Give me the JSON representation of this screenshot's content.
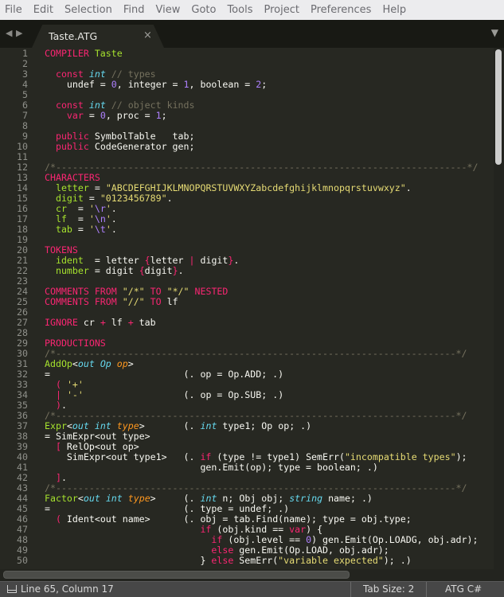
{
  "menu": [
    "File",
    "Edit",
    "Selection",
    "Find",
    "View",
    "Goto",
    "Tools",
    "Project",
    "Preferences",
    "Help"
  ],
  "tab": {
    "title": "Taste.ATG",
    "close": "×"
  },
  "icons": {
    "nav_back": "◀",
    "nav_forward": "▶",
    "tab_menu": "▼"
  },
  "colors": {
    "background": "#272822",
    "keyword": "#f92672",
    "entity": "#a6e22e",
    "type": "#66d9ef",
    "parameter": "#fd971f",
    "string": "#e6db74",
    "comment": "#75715e",
    "number": "#ae81ff",
    "text": "#f8f8f2"
  },
  "status": {
    "position": "Line 65, Column 17",
    "tab_size": "Tab Size: 2",
    "syntax": "ATG C#"
  },
  "lines": [
    [
      [
        "k",
        "COMPILER"
      ],
      [
        "p",
        " "
      ],
      [
        "g",
        "Taste"
      ]
    ],
    [],
    [
      [
        "p",
        "  "
      ],
      [
        "k",
        "const"
      ],
      [
        "p",
        " "
      ],
      [
        "t",
        "int"
      ],
      [
        "p",
        " "
      ],
      [
        "c",
        "// types"
      ]
    ],
    [
      [
        "p",
        "    undef = "
      ],
      [
        "n",
        "0"
      ],
      [
        "p",
        ", integer = "
      ],
      [
        "n",
        "1"
      ],
      [
        "p",
        ", boolean = "
      ],
      [
        "n",
        "2"
      ],
      [
        "p",
        ";"
      ]
    ],
    [],
    [
      [
        "p",
        "  "
      ],
      [
        "k",
        "const"
      ],
      [
        "p",
        " "
      ],
      [
        "t",
        "int"
      ],
      [
        "p",
        " "
      ],
      [
        "c",
        "// object kinds"
      ]
    ],
    [
      [
        "p",
        "    "
      ],
      [
        "k",
        "var"
      ],
      [
        "p",
        " = "
      ],
      [
        "n",
        "0"
      ],
      [
        "p",
        ", proc = "
      ],
      [
        "n",
        "1"
      ],
      [
        "p",
        ";"
      ]
    ],
    [],
    [
      [
        "p",
        "  "
      ],
      [
        "k",
        "public"
      ],
      [
        "p",
        " SymbolTable   tab;"
      ]
    ],
    [
      [
        "p",
        "  "
      ],
      [
        "k",
        "public"
      ],
      [
        "p",
        " CodeGenerator gen;"
      ]
    ],
    [],
    [
      [
        "c",
        "/*--------------------------------------------------------------------------*/"
      ]
    ],
    [
      [
        "k",
        "CHARACTERS"
      ]
    ],
    [
      [
        "p",
        "  "
      ],
      [
        "g",
        "letter"
      ],
      [
        "p",
        " = "
      ],
      [
        "s",
        "\"ABCDEFGHIJKLMNOPQRSTUVWXYZabcdefghijklmnopqrstuvwxyz\""
      ],
      [
        "p",
        "."
      ]
    ],
    [
      [
        "p",
        "  "
      ],
      [
        "g",
        "digit"
      ],
      [
        "p",
        " = "
      ],
      [
        "s",
        "\"0123456789\""
      ],
      [
        "p",
        "."
      ]
    ],
    [
      [
        "p",
        "  "
      ],
      [
        "g",
        "cr"
      ],
      [
        "p",
        "  = "
      ],
      [
        "s",
        "'"
      ],
      [
        "n",
        "\\r"
      ],
      [
        "s",
        "'"
      ],
      [
        "p",
        "."
      ]
    ],
    [
      [
        "p",
        "  "
      ],
      [
        "g",
        "lf"
      ],
      [
        "p",
        "  = "
      ],
      [
        "s",
        "'"
      ],
      [
        "n",
        "\\n"
      ],
      [
        "s",
        "'"
      ],
      [
        "p",
        "."
      ]
    ],
    [
      [
        "p",
        "  "
      ],
      [
        "g",
        "tab"
      ],
      [
        "p",
        " = "
      ],
      [
        "s",
        "'"
      ],
      [
        "n",
        "\\t"
      ],
      [
        "s",
        "'"
      ],
      [
        "p",
        "."
      ]
    ],
    [],
    [
      [
        "k",
        "TOKENS"
      ]
    ],
    [
      [
        "p",
        "  "
      ],
      [
        "g",
        "ident"
      ],
      [
        "p",
        "  = letter "
      ],
      [
        "k",
        "{"
      ],
      [
        "p",
        "letter "
      ],
      [
        "k",
        "|"
      ],
      [
        "p",
        " digit"
      ],
      [
        "k",
        "}"
      ],
      [
        "p",
        "."
      ]
    ],
    [
      [
        "p",
        "  "
      ],
      [
        "g",
        "number"
      ],
      [
        "p",
        " = digit "
      ],
      [
        "k",
        "{"
      ],
      [
        "p",
        "digit"
      ],
      [
        "k",
        "}"
      ],
      [
        "p",
        "."
      ]
    ],
    [],
    [
      [
        "k",
        "COMMENTS FROM"
      ],
      [
        "p",
        " "
      ],
      [
        "s",
        "\"/*\""
      ],
      [
        "p",
        " "
      ],
      [
        "k",
        "TO"
      ],
      [
        "p",
        " "
      ],
      [
        "s",
        "\"*/\""
      ],
      [
        "p",
        " "
      ],
      [
        "k",
        "NESTED"
      ]
    ],
    [
      [
        "k",
        "COMMENTS FROM"
      ],
      [
        "p",
        " "
      ],
      [
        "s",
        "\"//\""
      ],
      [
        "p",
        " "
      ],
      [
        "k",
        "TO"
      ],
      [
        "p",
        " lf"
      ]
    ],
    [],
    [
      [
        "k",
        "IGNORE"
      ],
      [
        "p",
        " cr "
      ],
      [
        "k",
        "+"
      ],
      [
        "p",
        " lf "
      ],
      [
        "k",
        "+"
      ],
      [
        "p",
        " tab"
      ]
    ],
    [],
    [
      [
        "k",
        "PRODUCTIONS"
      ]
    ],
    [
      [
        "c",
        "/*------------------------------------------------------------------------*/"
      ]
    ],
    [
      [
        "g",
        "AddOp"
      ],
      [
        "p",
        "<"
      ],
      [
        "t",
        "out"
      ],
      [
        "p",
        " "
      ],
      [
        "t",
        "Op"
      ],
      [
        "p",
        " "
      ],
      [
        "o",
        "op"
      ],
      [
        "p",
        ">"
      ]
    ],
    [
      [
        "p",
        "=                        (. op = Op.ADD; .)"
      ]
    ],
    [
      [
        "p",
        "  "
      ],
      [
        "k",
        "("
      ],
      [
        "p",
        " "
      ],
      [
        "s",
        "'+'"
      ]
    ],
    [
      [
        "p",
        "  "
      ],
      [
        "k",
        "|"
      ],
      [
        "p",
        " "
      ],
      [
        "s",
        "'-'"
      ],
      [
        "p",
        "                  (. op = Op.SUB; .)"
      ]
    ],
    [
      [
        "p",
        "  "
      ],
      [
        "k",
        ")"
      ],
      [
        "p",
        "."
      ]
    ],
    [
      [
        "c",
        "/*------------------------------------------------------------------------*/"
      ]
    ],
    [
      [
        "g",
        "Expr"
      ],
      [
        "p",
        "<"
      ],
      [
        "t",
        "out"
      ],
      [
        "p",
        " "
      ],
      [
        "t",
        "int"
      ],
      [
        "p",
        " "
      ],
      [
        "o",
        "type"
      ],
      [
        "p",
        ">"
      ],
      [
        "p",
        "       (. "
      ],
      [
        "t",
        "int"
      ],
      [
        "p",
        " type1; Op op; .)"
      ]
    ],
    [
      [
        "p",
        "= SimExpr<out type>"
      ]
    ],
    [
      [
        "p",
        "  "
      ],
      [
        "k",
        "["
      ],
      [
        "p",
        " RelOp<out op>"
      ]
    ],
    [
      [
        "p",
        "    SimExpr<out type1>   (. "
      ],
      [
        "k",
        "if"
      ],
      [
        "p",
        " (type != type1) SemErr("
      ],
      [
        "s",
        "\"incompatible types\""
      ],
      [
        "p",
        ");"
      ]
    ],
    [
      [
        "p",
        "                            gen.Emit(op); type = boolean; .)"
      ]
    ],
    [
      [
        "p",
        "  "
      ],
      [
        "k",
        "]"
      ],
      [
        "p",
        "."
      ]
    ],
    [
      [
        "c",
        "/*------------------------------------------------------------------------*/"
      ]
    ],
    [
      [
        "g",
        "Factor"
      ],
      [
        "p",
        "<"
      ],
      [
        "t",
        "out"
      ],
      [
        "p",
        " "
      ],
      [
        "t",
        "int"
      ],
      [
        "p",
        " "
      ],
      [
        "o",
        "type"
      ],
      [
        "p",
        ">"
      ],
      [
        "p",
        "     (. "
      ],
      [
        "t",
        "int"
      ],
      [
        "p",
        " n; Obj obj; "
      ],
      [
        "t",
        "string"
      ],
      [
        "p",
        " name; .)"
      ]
    ],
    [
      [
        "p",
        "=                        (. type = undef; .)"
      ]
    ],
    [
      [
        "p",
        "  "
      ],
      [
        "k",
        "("
      ],
      [
        "p",
        " Ident<out name>      (. obj = tab.Find(name); type = obj.type;"
      ]
    ],
    [
      [
        "p",
        "                            "
      ],
      [
        "k",
        "if"
      ],
      [
        "p",
        " (obj.kind == "
      ],
      [
        "k",
        "var"
      ],
      [
        "p",
        ") {"
      ]
    ],
    [
      [
        "p",
        "                              "
      ],
      [
        "k",
        "if"
      ],
      [
        "p",
        " (obj.level == "
      ],
      [
        "n",
        "0"
      ],
      [
        "p",
        ") gen.Emit(Op.LOADG, obj.adr);"
      ]
    ],
    [
      [
        "p",
        "                              "
      ],
      [
        "k",
        "else"
      ],
      [
        "p",
        " gen.Emit(Op.LOAD, obj.adr);"
      ]
    ],
    [
      [
        "p",
        "                            } "
      ],
      [
        "k",
        "else"
      ],
      [
        "p",
        " SemErr("
      ],
      [
        "s",
        "\"variable expected\""
      ],
      [
        "p",
        "); .)"
      ]
    ]
  ]
}
